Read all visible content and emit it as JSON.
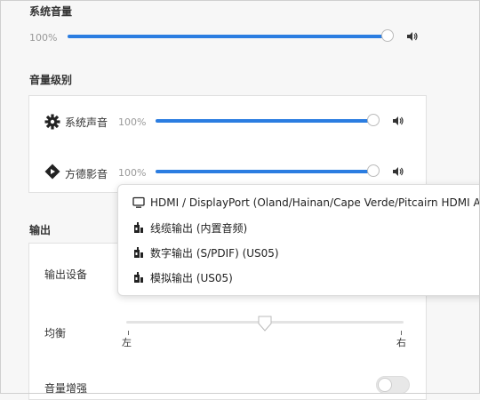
{
  "system_volume": {
    "title": "系统音量",
    "percent_label": "100%",
    "level": 1.0
  },
  "volume_levels": {
    "title": "音量级别",
    "items": [
      {
        "label": "系统声音",
        "percent_label": "100%",
        "level": 1.0,
        "icon": "gear-icon"
      },
      {
        "label": "方德影音",
        "percent_label": "100%",
        "level": 1.0,
        "icon": "media-player-icon"
      }
    ]
  },
  "output": {
    "title": "输出",
    "device_label": "输出设备",
    "balance_label": "均衡",
    "balance_left": "左",
    "balance_right": "右",
    "balance_value": 0.5,
    "boost_label": "音量增强",
    "boost_enabled": false
  },
  "device_menu": {
    "options": [
      {
        "label": "HDMI / DisplayPort (Oland/Hainan/Cape Verde/Pitcairn HDMI Au",
        "icon": "monitor-icon"
      },
      {
        "label": "线缆输出 (内置音频)",
        "icon": "audio-port-icon"
      },
      {
        "label": "数字输出 (S/PDIF) (US05)",
        "icon": "audio-port-icon"
      },
      {
        "label": "模拟输出 (US05)",
        "icon": "audio-port-icon"
      }
    ]
  },
  "colors": {
    "accent": "#2b7de1",
    "track": "#dcdcdc",
    "card": "#ffffff",
    "background": "#f7f7f7"
  }
}
